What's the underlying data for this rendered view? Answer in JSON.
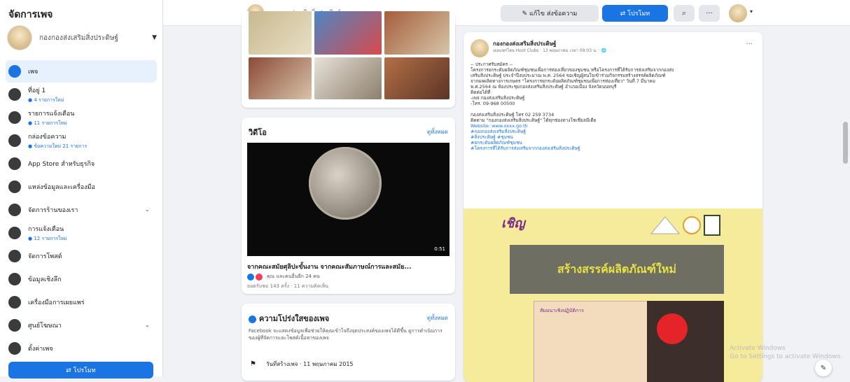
{
  "sidebar": {
    "title": "จัดการเพจ",
    "page_name": "กองกองส่งเสริมสิ่งประดิษฐ์",
    "items": [
      {
        "label": "เพจ",
        "sub": "",
        "icon": "home-icon",
        "active": true,
        "chevron": ""
      },
      {
        "label": "ที่อยู่ 1",
        "sub": "● 4 รายการใหม่",
        "icon": "inbox-icon",
        "active": false,
        "chevron": ""
      },
      {
        "label": "รายการแจ้งเตือน",
        "sub": "● 11 รายการใหม่",
        "icon": "bell-icon",
        "active": false,
        "chevron": ""
      },
      {
        "label": "กล่องข้อความ",
        "sub": "● ข้อความใหม่ 21 รายการ",
        "icon": "messenger-icon",
        "active": false,
        "chevron": ""
      },
      {
        "label": "App Store สำหรับธุรกิจ",
        "sub": "",
        "icon": "app-store-icon",
        "active": false,
        "chevron": ""
      },
      {
        "label": "แหล่งข้อมูลและเครื่องมือ",
        "sub": "",
        "icon": "info-icon",
        "active": false,
        "chevron": ""
      },
      {
        "label": "จัดการร้านของเรา",
        "sub": "",
        "icon": "shop-icon",
        "active": false,
        "chevron": "⌄"
      },
      {
        "label": "การแจ้งเตือน",
        "sub": "● 12 รายการใหม่",
        "icon": "alert-icon",
        "active": false,
        "chevron": ""
      },
      {
        "label": "จัดการโพสต์",
        "sub": "",
        "icon": "briefcase-icon",
        "active": false,
        "chevron": ""
      },
      {
        "label": "ข้อมูลเชิงลึก",
        "sub": "",
        "icon": "insights-icon",
        "active": false,
        "chevron": ""
      },
      {
        "label": "เครื่องมือการเผยแพร่",
        "sub": "",
        "icon": "publishing-tools-icon",
        "active": false,
        "chevron": ""
      },
      {
        "label": "ศูนย์โฆษณา",
        "sub": "",
        "icon": "megaphone-icon",
        "active": false,
        "chevron": "⌄"
      },
      {
        "label": "ตั้งค่าเพจ",
        "sub": "",
        "icon": "gear-icon",
        "active": false,
        "chevron": ""
      }
    ],
    "promote_button": "⇄ โปรโมท"
  },
  "topbar": {
    "page_name": "กองกองส่งเสริมสิ่งประดิษฐ์",
    "edit_button": "✎ แก้ไข ส่งข้อความ",
    "send_button": "⇄ โปรโมท",
    "search_icon": "⌕",
    "more_icon": "···",
    "caret": "▾"
  },
  "videos": {
    "title": "วิดีโอ",
    "see_all": "ดูทั้งหมด",
    "duration": "0:51",
    "video_title": "จากคณะสมัยศุลิปะขั้นงาน จากคณะสัมภาษณ์การและสมัย...",
    "reactions": "คุณ และคนอื่นอีก 24 คน",
    "views": "ยอดรับชม 143 ครั้ง · 11 ความคิดเห็น"
  },
  "transparency": {
    "title": "ความโปร่งใสของเพจ",
    "see_all": "ดูทั้งหมด",
    "description": "Facebook จะแสดงข้อมูลเพื่อช่วยให้คุณเข้าใจถึงจุดประสงค์ของเพจได้ดีขึ้น ดูการดำเนินการของผู้ที่จัดการและโพสต์เนื้อหาของเพจ",
    "created": "วันที่สร้างเพจ · 11 พฤษภาคม 2015",
    "flag_icon": "⚑"
  },
  "post": {
    "author": "กองกองส่งเสริมสิ่งประดิษฐ์",
    "meta": "เผยแพร่โดย Hoot Clubs · 13 พฤษภาคม เวลา 09:03 น. · 🌐",
    "more": "···",
    "body_lines": [
      "-- ประกาศรับสมัคร --",
      "โครงการยกระดับผลิตภัณฑ์ชุมชนเพื่อการท่องเที่ยวของชุมชน หรือโครงการที่ได้รับการส่งเสริมจากกองส่ง",
      "เสริมสิ่งประดิษฐ์ ประจำปีงบประมาณ พ.ศ. 2564 ขอเชิญผู้สนใจเข้าร่วมกิจกรรมสร้างสรรค์ผลิตภัณฑ์",
      "จากผลผลิตทางการเกษตร \"โครงการยกระดับผลิตภัณฑ์ชุมชนเพื่อการท่องเที่ยว\" วันที่ 7 มีนาคม",
      "พ.ศ.2564 ณ ห้องประชุมกองส่งเสริมสิ่งประดิษฐ์ อำเภอเมือง จังหวัดนนทบุรี",
      "ติดต่อได้ที่",
      "-เพจ กองส่งเสริมสิ่งประดิษฐ์",
      "-โทร. 09-968 00500",
      "",
      "กองส่งเสริมสิ่งประดิษฐ์ โทร 02 259 3734",
      "ติดตาม \"กองกองส่งเสริมสิ่งประดิษฐ์\" ได้ทุกช่องทางโซเชียลมีเดีย"
    ],
    "links": [
      "Website: www.xxxx.go.th",
      "#กองกองส่งเสริมสิ่งประดิษฐ์",
      "#สิ่งประดิษฐ์ #ชุมชน",
      "#ยกระดับผลิตภัณฑ์ชุมชน",
      "#โครงการที่ได้รับการส่งเสริมจากกองส่งเสริมสิ่งประดิษฐ์"
    ],
    "banner_title": "เชิญ",
    "banner_sub": "สัมมนาเชิงปฏิบัติการ",
    "banner_text": "สร้างสรรค์ผลิตภัณฑ์ใหม่"
  },
  "watermark": {
    "line1": "Activate Windows",
    "line2": "Go to Settings to activate Windows."
  },
  "compose_icon": "✎",
  "colors": {
    "accent": "#1b74e4",
    "page_bg": "#f0f2f5"
  }
}
